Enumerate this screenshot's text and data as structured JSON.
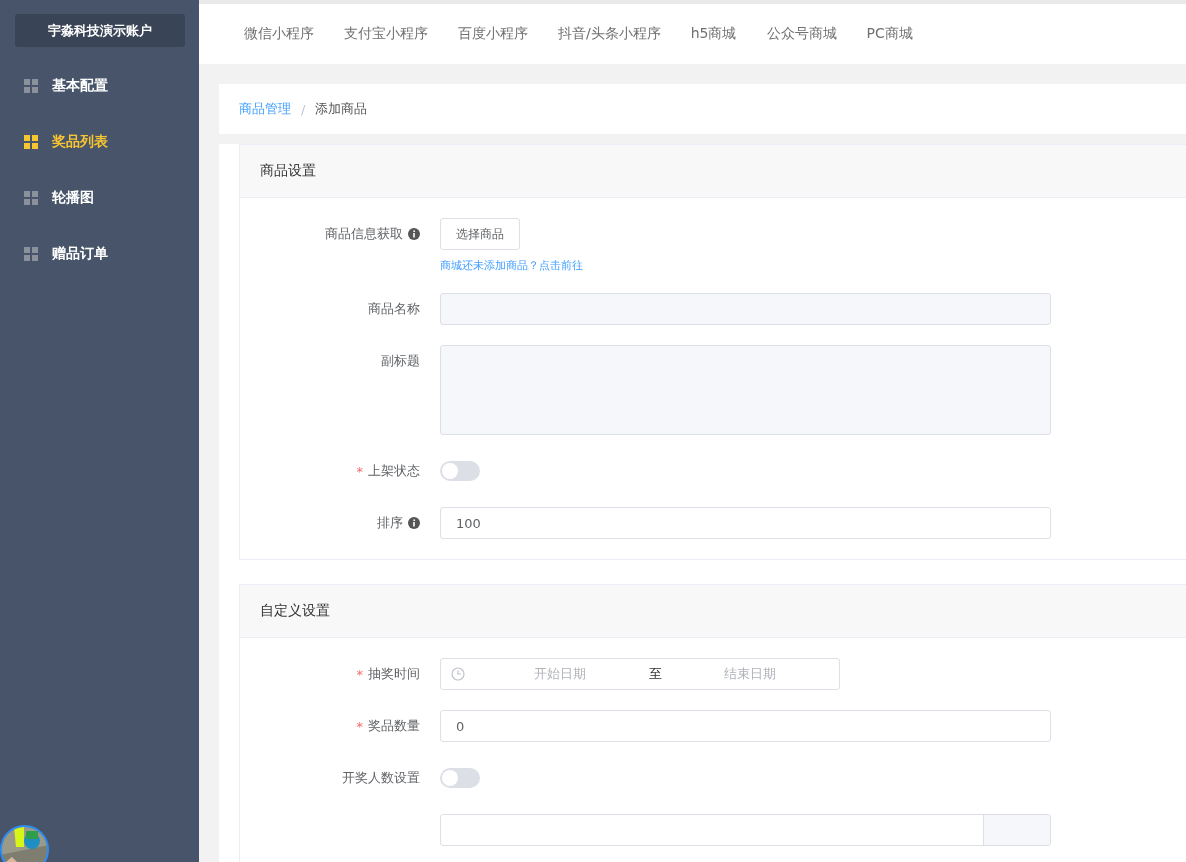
{
  "sidebar": {
    "account": "宇淼科技演示账户",
    "items": [
      {
        "label": "基本配置",
        "selected": false
      },
      {
        "label": "奖品列表",
        "selected": true
      },
      {
        "label": "轮播图",
        "selected": false
      },
      {
        "label": "赠品订单",
        "selected": false
      }
    ]
  },
  "top_tabs": [
    "微信小程序",
    "支付宝小程序",
    "百度小程序",
    "抖音/头条小程序",
    "h5商城",
    "公众号商城",
    "PC商城"
  ],
  "breadcrumb": {
    "parent": "商品管理",
    "separator": "/",
    "current": "添加商品"
  },
  "sections": [
    {
      "title": "商品设置",
      "fields": [
        {
          "kind": "button",
          "label": "商品信息获取",
          "info": true,
          "button": "选择商品",
          "hint": "商城还未添加商品？点击前往"
        },
        {
          "kind": "disabled_input",
          "label": "商品名称",
          "info": false
        },
        {
          "kind": "textarea",
          "label": "副标题",
          "info": false
        },
        {
          "kind": "switch",
          "required_mark": "*",
          "label": "上架状态",
          "info": false,
          "on": false
        },
        {
          "kind": "input",
          "label": "排序",
          "info": true,
          "value": "100"
        }
      ]
    },
    {
      "title": "自定义设置",
      "fields": [
        {
          "kind": "daterange",
          "required_mark": "*",
          "label": "抽奖时间",
          "info": false,
          "start": "开始日期",
          "separator": "至",
          "end": "结束日期"
        },
        {
          "kind": "input",
          "required_mark": "*",
          "label": "奖品数量",
          "info": false,
          "value": "0"
        },
        {
          "kind": "switch",
          "label": "开奖人数设置",
          "info": false,
          "on": false
        },
        {
          "kind": "addon_input"
        }
      ]
    }
  ]
}
